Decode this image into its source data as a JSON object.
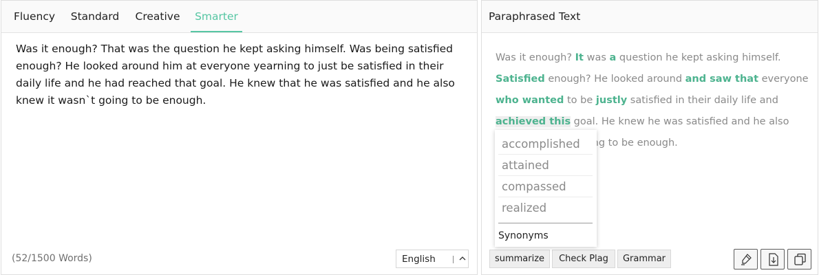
{
  "tabs": [
    {
      "label": "Fluency",
      "active": false
    },
    {
      "label": "Standard",
      "active": false
    },
    {
      "label": "Creative",
      "active": false
    },
    {
      "label": "Smarter",
      "active": true
    }
  ],
  "accent_color": "#56c6a3",
  "input": {
    "text": "Was it enough? That was the question he kept asking himself. Was being satisfied enough? He looked around him at everyone yearning to just be satisfied in their daily life and he had reached that goal. He knew that he was satisfied and he also knew it wasn`t going to be enough.",
    "word_count": "(52/1500 Words)"
  },
  "language": {
    "selected": "English"
  },
  "output": {
    "title": "Paraphrased Text",
    "s1": "Was it enough? ",
    "s2": "It",
    "s3": " was ",
    "s4": "a",
    "s5": " question he kept asking himself. ",
    "s6": "Satisfied",
    "s7": " enough? He looked around ",
    "s8": "and saw that",
    "s9": " everyone ",
    "s10": "who wanted",
    "s11": " to be ",
    "s12": "justly",
    "s13": " satisfied in their daily life and ",
    "s14": "achieved this",
    "s15": " goal. He knew he was satisfied and he also knew it was not going to be enough."
  },
  "synonyms": {
    "options": [
      "accomplished",
      "attained",
      "compassed",
      "realized"
    ],
    "footer_label": "Synonyms"
  },
  "actions": {
    "summarize": "summarize",
    "check_plag": "Check Plag",
    "grammar": "Grammar"
  },
  "icons": [
    "highlighter-icon",
    "download-icon",
    "copy-icon"
  ]
}
